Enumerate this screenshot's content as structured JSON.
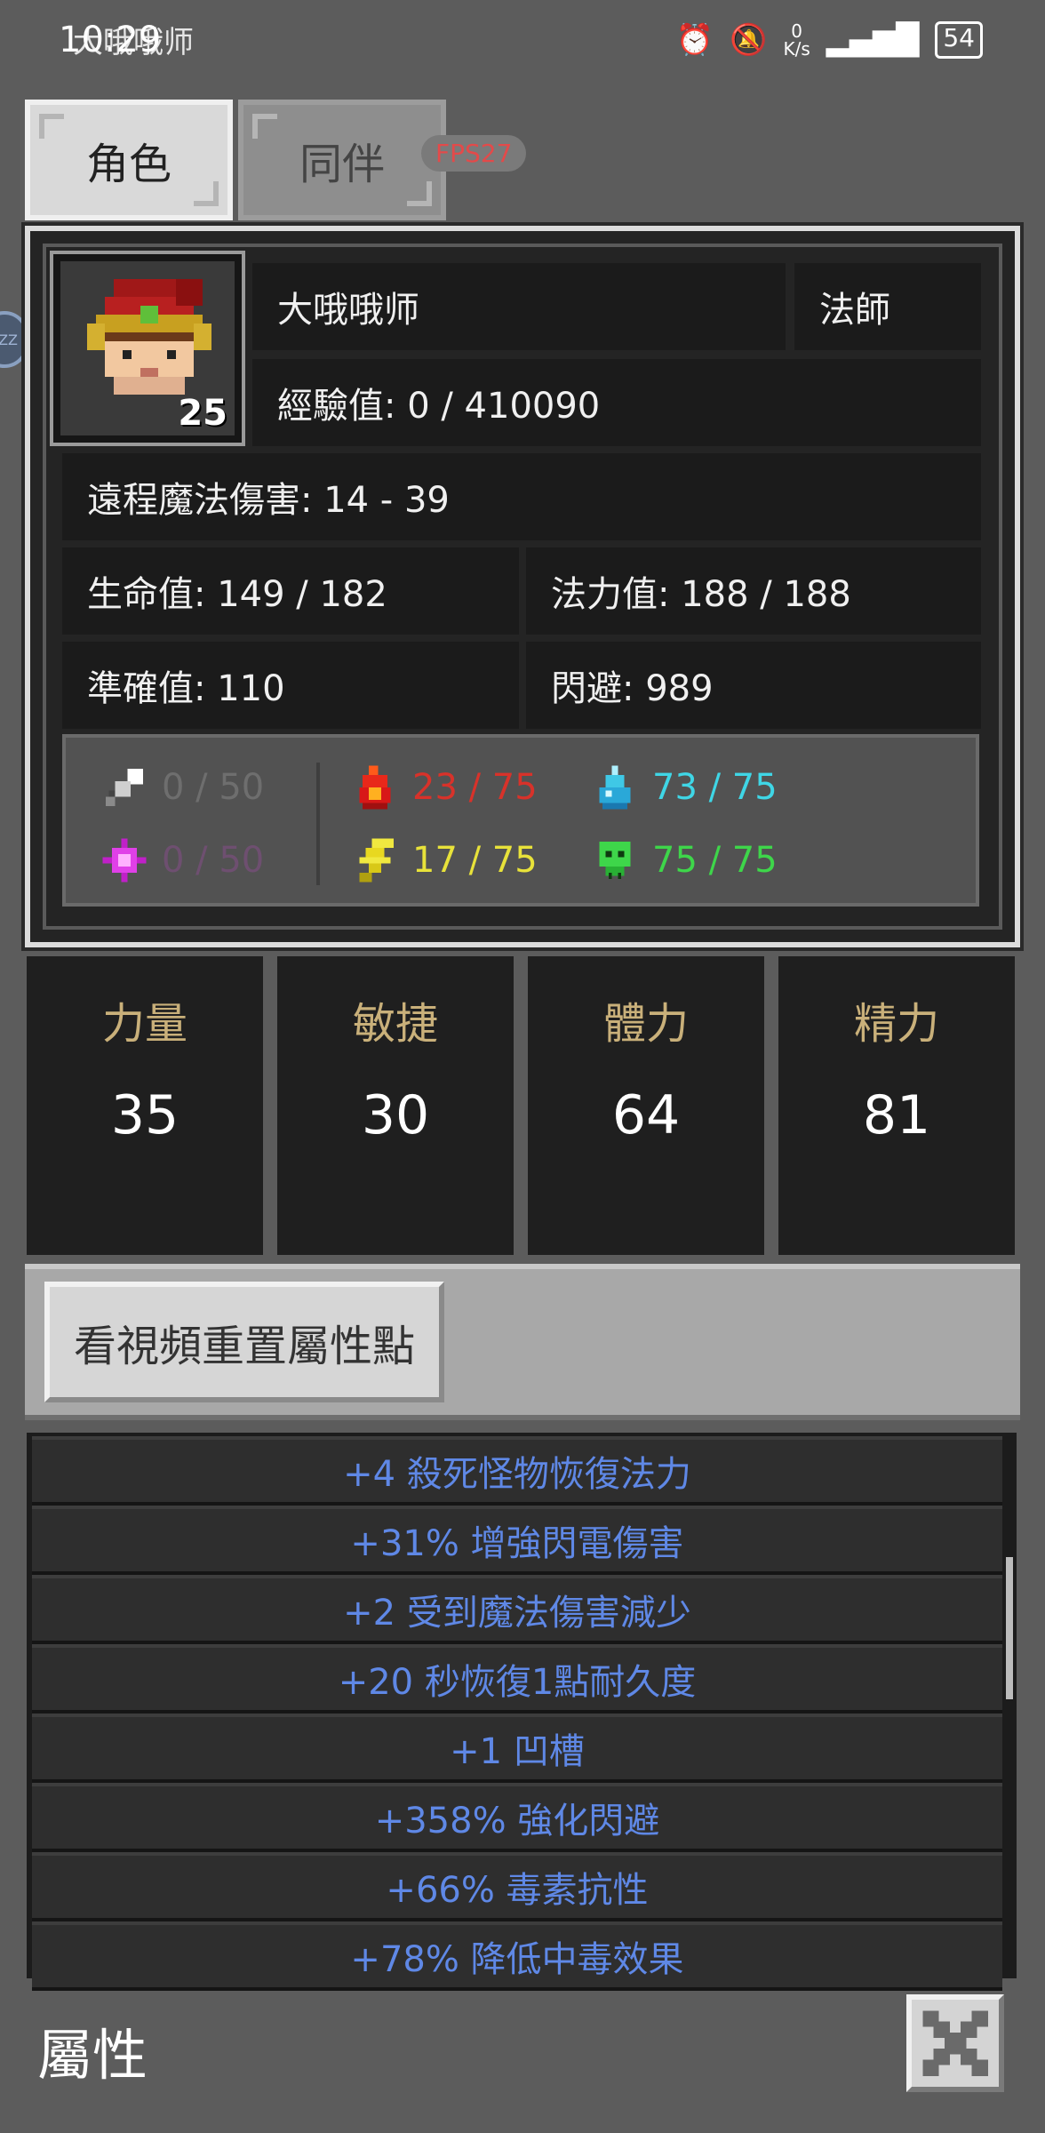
{
  "status_bar": {
    "time": "10:29",
    "overlay_text": "大哦哦师",
    "net_speed_value": "0",
    "net_speed_unit": "K/s",
    "clock_right": "10:29",
    "battery": "54"
  },
  "tabs": [
    {
      "label": "角色",
      "active": true
    },
    {
      "label": "同伴",
      "active": false
    }
  ],
  "fps": "FPS27",
  "side_bubble": "ZZ",
  "character": {
    "level": "25",
    "name": "大哦哦师",
    "class": "法師",
    "experience": "經驗值: 0 / 410090",
    "damage": "遠程魔法傷害: 14 - 39",
    "hp": "生命值: 149 / 182",
    "mp": "法力值: 188 / 188",
    "accuracy": "準確值: 110",
    "dodge": "閃避: 989"
  },
  "resistances": [
    {
      "icon": "sword-icon",
      "value": "0 / 50",
      "color": "#6e6e6e"
    },
    {
      "icon": "fire-icon",
      "value": "23 / 75",
      "color": "#d8322a"
    },
    {
      "icon": "water-drop-icon",
      "value": "73 / 75",
      "color": "#3fd6e6"
    },
    {
      "icon": "magic-star-icon",
      "value": "0 / 50",
      "color": "#6e4f70"
    },
    {
      "icon": "lightning-icon",
      "value": "17 / 75",
      "color": "#e8e23a"
    },
    {
      "icon": "skull-poison-icon",
      "value": "75 / 75",
      "color": "#3ed64a"
    }
  ],
  "attributes": [
    {
      "name": "力量",
      "value": "35"
    },
    {
      "name": "敏捷",
      "value": "30"
    },
    {
      "name": "體力",
      "value": "64"
    },
    {
      "name": "精力",
      "value": "81"
    }
  ],
  "reset_button": "看視頻重置屬性點",
  "bonuses": [
    "+4 殺死怪物恢復法力",
    "+31% 增強閃電傷害",
    "+2 受到魔法傷害減少",
    "+20 秒恢復1點耐久度",
    "+1 凹槽",
    "+358% 強化閃避",
    "+66% 毒素抗性",
    "+78% 降低中毒效果"
  ],
  "footer_title": "屬性",
  "colors": {
    "attr_name": "#c9b07a",
    "bonus_text": "#5f88e6",
    "panel_bg": "#242424"
  }
}
